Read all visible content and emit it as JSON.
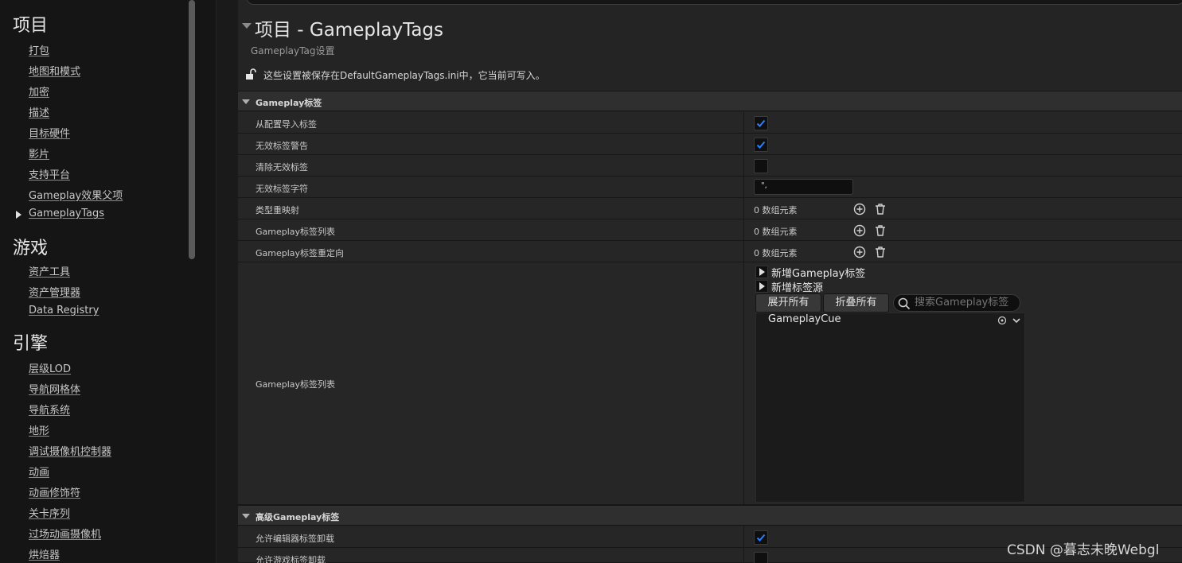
{
  "sidebar": {
    "sections": [
      {
        "title": "项目",
        "items": [
          "打包",
          "地图和模式",
          "加密",
          "描述",
          "目标硬件",
          "影片",
          "支持平台",
          "Gameplay效果父项",
          "GameplayTags"
        ]
      },
      {
        "title": "游戏",
        "items": [
          "资产工具",
          "资产管理器",
          "Data Registry"
        ]
      },
      {
        "title": "引擎",
        "items": [
          "层级LOD",
          "导航网格体",
          "导航系统",
          "地形",
          "调试摄像机控制器",
          "动画",
          "动画修饰符",
          "关卡序列",
          "过场动画摄像机",
          "烘焙器"
        ]
      }
    ],
    "selected_item": "GameplayTags"
  },
  "header": {
    "title": "项目 - GameplayTags",
    "subtitle": "GameplayTag设置",
    "config_note": "这些设置被保存在DefaultGameplayTags.ini中，它当前可写入。"
  },
  "categories": {
    "gameplay_tags": "Gameplay标签",
    "advanced": "高级Gameplay标签"
  },
  "properties": {
    "import_from_config": {
      "label": "从配置导入标签",
      "checked": true
    },
    "warn_invalid": {
      "label": "无效标签警告",
      "checked": true
    },
    "clear_invalid": {
      "label": "清除无效标签",
      "checked": false
    },
    "invalid_chars": {
      "label": "无效标签字符",
      "value": "\","
    },
    "category_remapping": {
      "label": "类型重映射",
      "count": "0 数组元素"
    },
    "tag_list": {
      "label": "Gameplay标签列表",
      "count": "0 数组元素"
    },
    "tag_redirects": {
      "label": "Gameplay标签重定向",
      "count": "0 数组元素"
    },
    "tag_list_editor": {
      "label": "Gameplay标签列表"
    },
    "allow_editor_unload": {
      "label": "允许编辑器标签卸载",
      "checked": true
    },
    "allow_game_unload": {
      "label": "允许游戏标签卸载",
      "checked": false
    }
  },
  "tag_editor": {
    "add_new_tag": "新增Gameplay标签",
    "add_new_source": "新增标签源",
    "expand_all": "展开所有",
    "collapse_all": "折叠所有",
    "search_placeholder": "搜索Gameplay标签",
    "tags": [
      "GameplayCue"
    ]
  },
  "watermark": "CSDN @暮志未晚Webgl",
  "colors": {
    "accent_check": "#2a7fff",
    "background": "#242424",
    "sidebar_bg": "#151515"
  }
}
